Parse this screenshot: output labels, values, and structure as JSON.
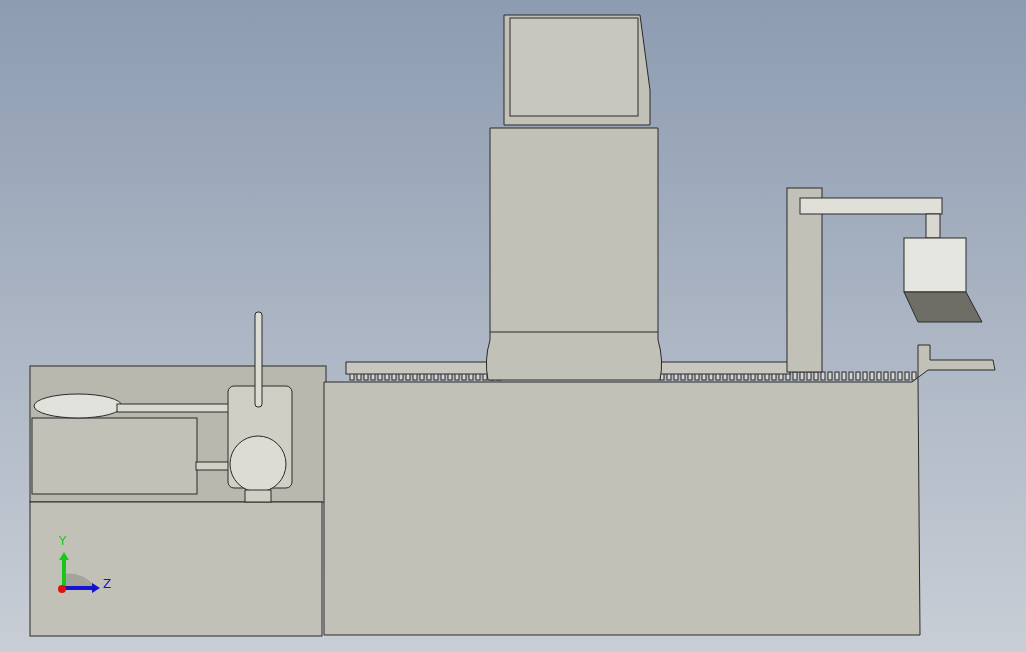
{
  "viewport": {
    "triad": {
      "axes": [
        {
          "label": "Y",
          "color": "#18c818"
        },
        {
          "label": "Z",
          "color": "#1414d0"
        }
      ]
    }
  }
}
